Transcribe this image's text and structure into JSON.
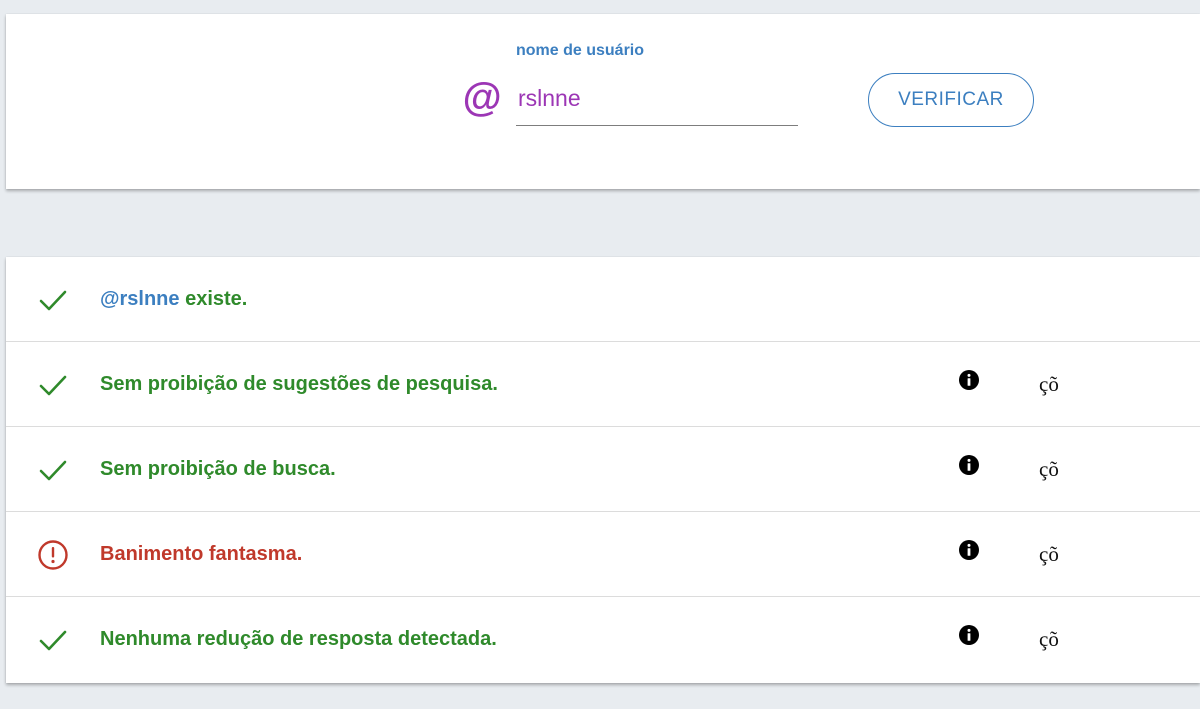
{
  "search": {
    "label": "nome de usuário",
    "at_symbol": "@",
    "value": "rslnne",
    "verify_label": "VERIFICAR"
  },
  "results": [
    {
      "status": "ok",
      "handle": "@rslnne",
      "text": " existe."
    },
    {
      "status": "ok",
      "text": "Sem proibição de sugestões de pesquisa.",
      "extra": "çõ"
    },
    {
      "status": "ok",
      "text": "Sem proibição de busca.",
      "extra": "çõ"
    },
    {
      "status": "error",
      "text": "Banimento fantasma.",
      "extra": "çõ"
    },
    {
      "status": "ok",
      "text": "Nenhuma redução de resposta detectada.",
      "extra": "çõ"
    }
  ],
  "icons": {
    "ok": "check-icon",
    "error": "alert-circle-icon",
    "info": "info-icon"
  },
  "colors": {
    "ok": "#2f8a2b",
    "error": "#c0392b",
    "accent": "#3c7fc0",
    "username": "#9c36b5",
    "background": "#e8ecf0"
  }
}
